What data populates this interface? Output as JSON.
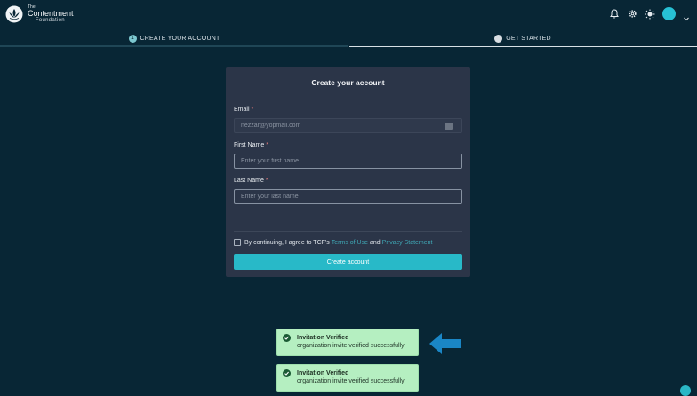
{
  "header": {
    "logo": {
      "the": "The",
      "name": "Contentment",
      "foundation": "··· Foundation ···"
    },
    "icons": [
      "bell-icon",
      "gear-icon",
      "sun-icon",
      "avatar",
      "chevron-down-icon"
    ],
    "avatar_color": "#27c0d4"
  },
  "stepper": {
    "steps": [
      {
        "number": "1",
        "label": "CREATE YOUR ACCOUNT",
        "active": true
      },
      {
        "number": "",
        "label": "GET STARTED",
        "active": false
      }
    ]
  },
  "form": {
    "title": "Create your account",
    "email": {
      "label": "Email",
      "required_mark": "*",
      "value": "",
      "placeholder": "nezzar@yopmail.com"
    },
    "first_name": {
      "label": "First Name",
      "required_mark": "*",
      "value": "",
      "placeholder": "Enter your first name"
    },
    "last_name": {
      "label": "Last Name",
      "required_mark": "*",
      "value": "",
      "placeholder": "Enter your last name"
    },
    "terms": {
      "prefix": "By continuing, I agree to TCF's",
      "terms_link": "Terms of Use",
      "and": "and",
      "privacy_link": "Privacy Statement",
      "checked": false
    },
    "submit_label": "Create account"
  },
  "toasts": [
    {
      "title": "Invitation Verified",
      "message": "organization invite verified successfully"
    },
    {
      "title": "Invitation Verified",
      "message": "organization invite verified successfully"
    }
  ],
  "colors": {
    "background": "#082635",
    "card": "#2b3548",
    "accent": "#28b9c8",
    "toast": "#b5efc1",
    "arrow": "#1a86c6"
  }
}
